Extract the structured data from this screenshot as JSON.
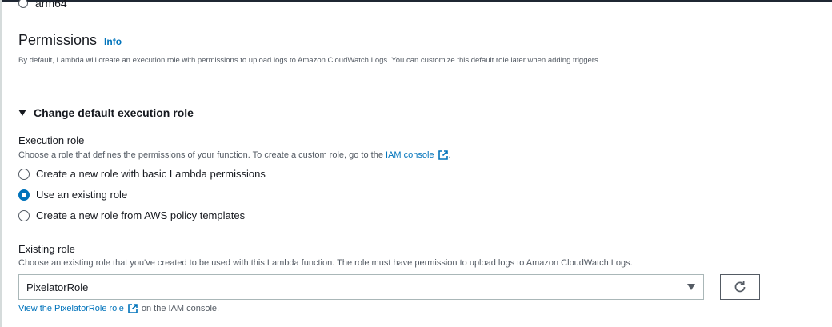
{
  "architecture": {
    "option_label": "arm64"
  },
  "permissions": {
    "title": "Permissions",
    "info_label": "Info",
    "description": "By default, Lambda will create an execution role with permissions to upload logs to Amazon CloudWatch Logs. You can customize this default role later when adding triggers."
  },
  "execution_role_section": {
    "expander_label": "Change default execution role",
    "label": "Execution role",
    "description_prefix": "Choose a role that defines the permissions of your function. To create a custom role, go to the",
    "description_link": "IAM console",
    "description_suffix": ".",
    "options": [
      {
        "label": "Create a new role with basic Lambda permissions",
        "selected": false
      },
      {
        "label": "Use an existing role",
        "selected": true
      },
      {
        "label": "Create a new role from AWS policy templates",
        "selected": false
      }
    ]
  },
  "existing_role": {
    "label": "Existing role",
    "description": "Choose an existing role that you've created to be used with this Lambda function. The role must have permission to upload logs to Amazon CloudWatch Logs.",
    "selected_value": "PixelatorRole",
    "view_link": "View the PixelatorRole role",
    "view_suffix": "on the IAM console."
  },
  "colors": {
    "link": "#0073bb",
    "text": "#16191f",
    "muted": "#545b64",
    "selected_radio": "#0073bb"
  },
  "icons": [
    "external-link-icon",
    "refresh-icon",
    "caret-down-icon",
    "caret-expanded-icon"
  ]
}
